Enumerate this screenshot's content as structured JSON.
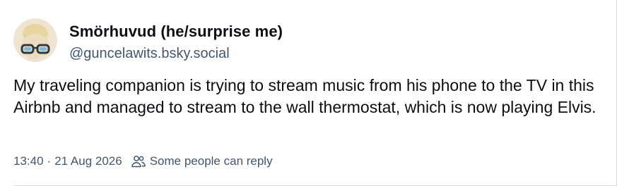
{
  "author": {
    "display_name": "Smörhuvud (he/surprise me)",
    "handle": "@guncelawits.bsky.social",
    "avatar_icon": "avatar-glasses-icon"
  },
  "post": {
    "text": "My traveling companion is trying to stream music from his phone to the TV in this Airbnb and managed to stream to the wall thermostat, which is now playing Elvis."
  },
  "meta": {
    "time": "13:40",
    "separator": "·",
    "date": "21 Aug 2026",
    "reply_setting_icon": "people-icon",
    "reply_setting": "Some people can reply"
  },
  "colors": {
    "text": "#0b0f14",
    "secondary": "#42576c",
    "border": "#d4dbe2"
  }
}
